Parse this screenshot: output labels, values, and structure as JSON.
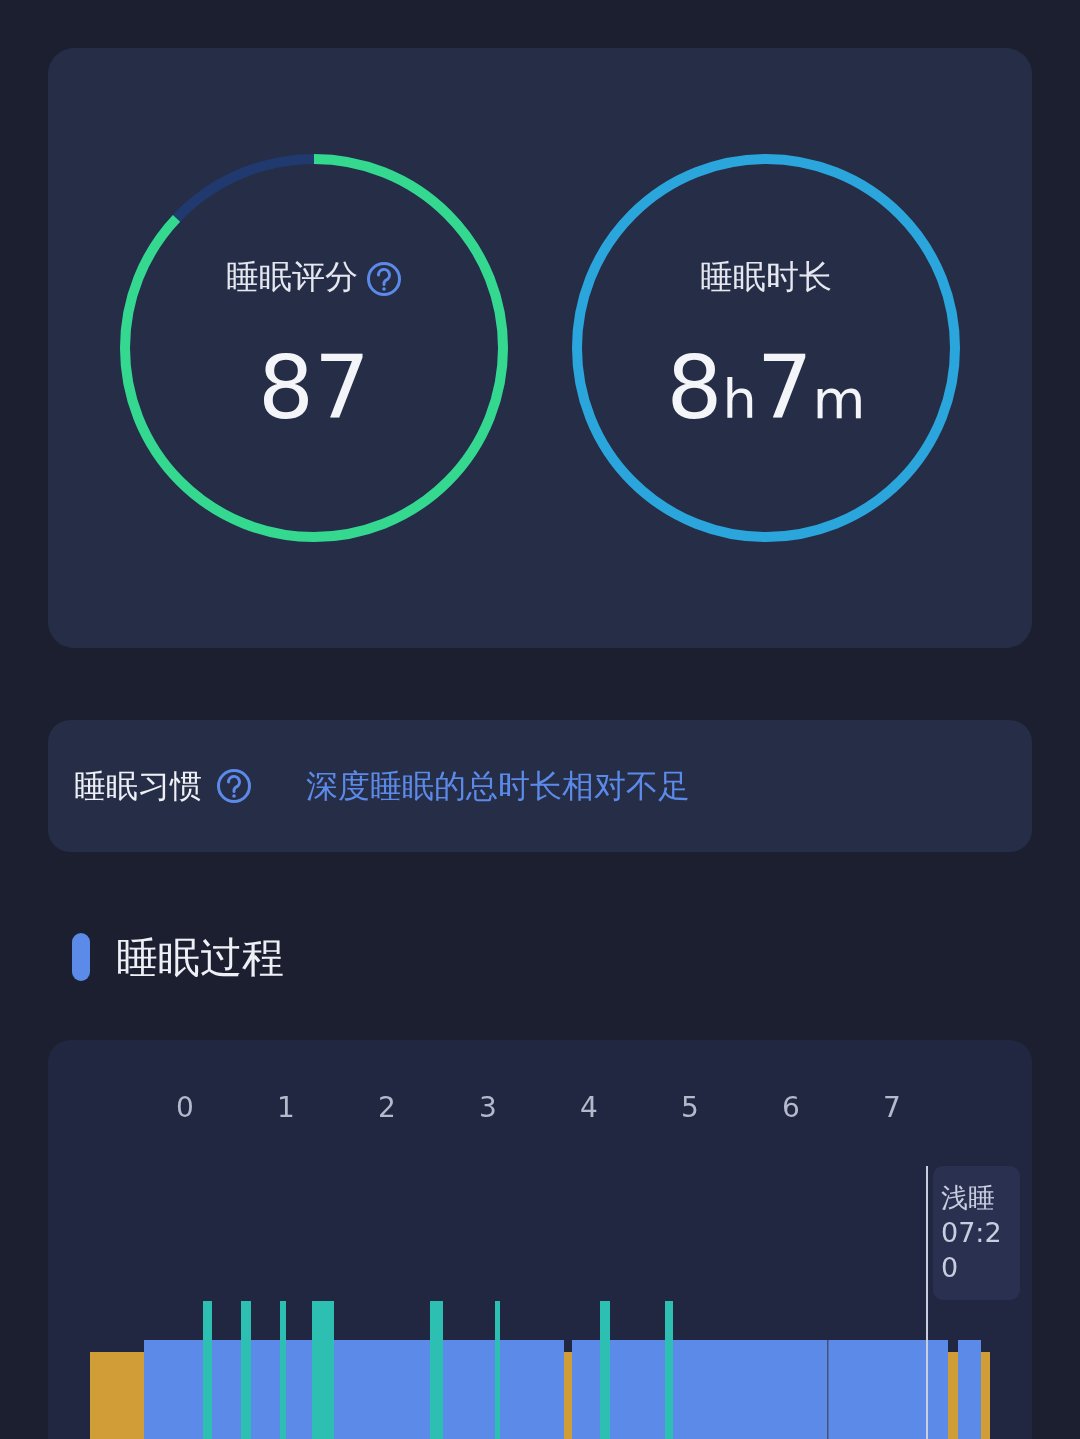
{
  "summary": {
    "score": {
      "label": "睡眠评分",
      "value": "87",
      "level": 0.87,
      "help": true
    },
    "duration": {
      "label": "睡眠时长",
      "hours": "8",
      "hours_unit": "h",
      "minutes": "7",
      "minutes_unit": "m",
      "level": 1
    }
  },
  "habit": {
    "label": "睡眠习惯",
    "help": true,
    "text": "深度睡眠的总时长相对不足"
  },
  "section": {
    "title": "睡眠过程"
  },
  "process_chart": {
    "hour_labels": [
      "0",
      "1",
      "2",
      "3",
      "4",
      "5",
      "6",
      "7"
    ],
    "tooltip": {
      "stage": "浅睡",
      "time": "07:20"
    }
  }
}
